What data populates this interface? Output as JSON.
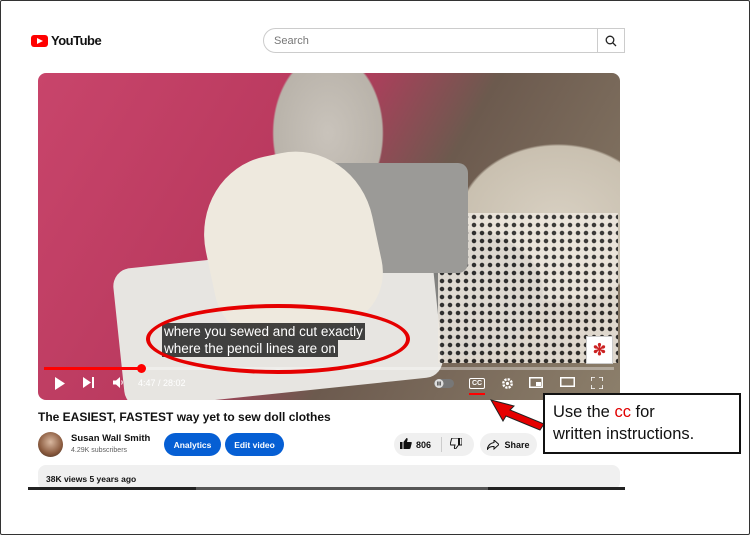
{
  "header": {
    "logo_text": "YouTube",
    "search_placeholder": "Search"
  },
  "player": {
    "caption_lines": [
      "where you sewed and cut exactly",
      "where the pencil lines are on"
    ],
    "time": "4:47 / 28:02",
    "progress_fraction": 0.171,
    "cc_label": "CC"
  },
  "video": {
    "title": "The EASIEST, FASTEST way yet to sew doll clothes",
    "channel_name": "Susan Wall Smith",
    "subscribers": "4.29K subscribers",
    "analytics_label": "Analytics",
    "edit_label": "Edit video",
    "likes": "806",
    "share_label": "Share",
    "views_line": "38K views  5 years ago"
  },
  "annotation": {
    "callout_before": "Use the ",
    "callout_highlight": "cc",
    "callout_after": " for",
    "callout_line2": "written instructions."
  },
  "colors": {
    "accent_red": "#ff0000",
    "button_blue": "#065fd4",
    "annotation_red": "#e50000"
  }
}
